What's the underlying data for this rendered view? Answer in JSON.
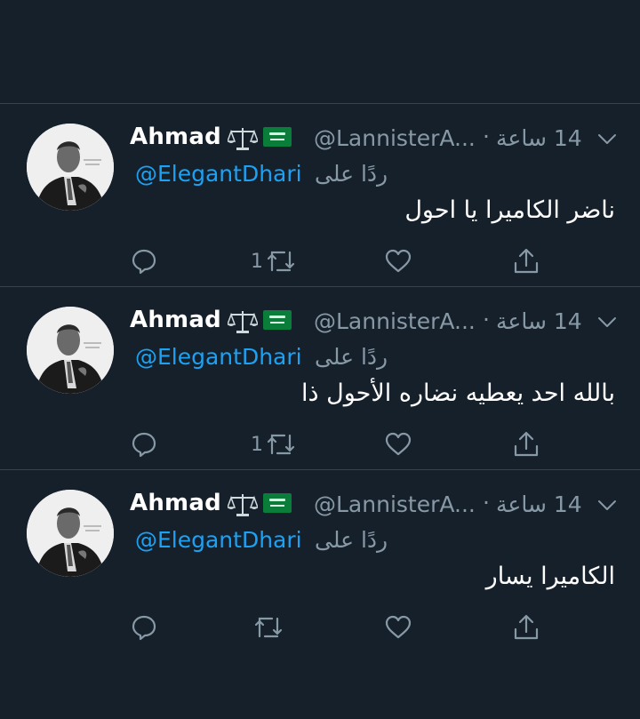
{
  "colors": {
    "background": "#15202b",
    "divider": "#38444d",
    "primary_text": "#ffffff",
    "secondary_text": "#8899a6",
    "link": "#1da1f2"
  },
  "tweets": [
    {
      "name": "Ahmad",
      "badges": [
        "scales-icon",
        "saudi-flag-icon"
      ],
      "handle": "@LannisterA...",
      "separator": "·",
      "time": "14 ساعة",
      "reply_prefix": "ردًا على",
      "reply_mention": "@ElegantDhari",
      "text": "ناضر الكاميرا يا احول",
      "retweet_count": "1",
      "actions": [
        "reply-icon",
        "retweet-icon",
        "like-icon",
        "share-icon"
      ]
    },
    {
      "name": "Ahmad",
      "badges": [
        "scales-icon",
        "saudi-flag-icon"
      ],
      "handle": "@LannisterA...",
      "separator": "·",
      "time": "14 ساعة",
      "reply_prefix": "ردًا على",
      "reply_mention": "@ElegantDhari",
      "text": "بالله احد يعطيه نضاره الأحول ذا",
      "retweet_count": "1",
      "actions": [
        "reply-icon",
        "retweet-icon",
        "like-icon",
        "share-icon"
      ]
    },
    {
      "name": "Ahmad",
      "badges": [
        "scales-icon",
        "saudi-flag-icon"
      ],
      "handle": "@LannisterA...",
      "separator": "·",
      "time": "14 ساعة",
      "reply_prefix": "ردًا على",
      "reply_mention": "@ElegantDhari",
      "text": "الكاميرا يسار",
      "retweet_count": "",
      "actions": [
        "reply-icon",
        "retweet-icon",
        "like-icon",
        "share-icon"
      ]
    }
  ]
}
